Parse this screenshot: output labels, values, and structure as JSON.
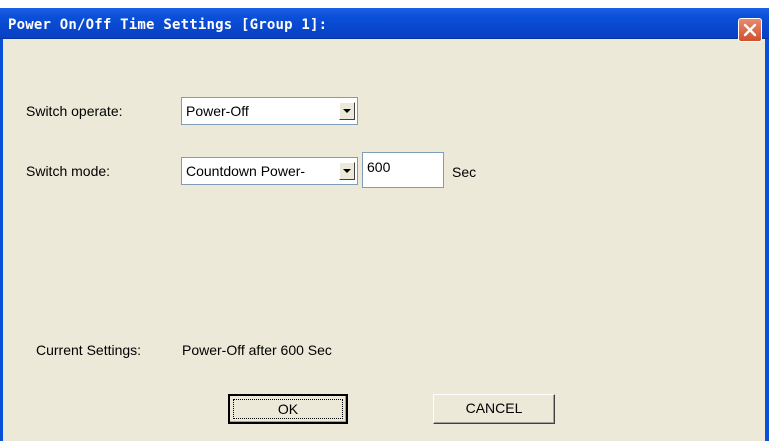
{
  "window": {
    "title": "Power On/Off Time Settings [Group 1]:",
    "close_icon": "close-icon"
  },
  "switch_operate": {
    "label": "Switch operate:",
    "value": "Power-Off"
  },
  "switch_mode": {
    "label": "Switch  mode:",
    "value": "Countdown Power-",
    "seconds_value": "600",
    "unit": "Sec"
  },
  "current_settings": {
    "label": "Current Settings:",
    "value": "Power-Off after 600 Sec"
  },
  "buttons": {
    "ok": "OK",
    "cancel": "CANCEL"
  },
  "colors": {
    "dialog_background": "#ece9d8",
    "titlebar": "#0a4fd8",
    "close_button": "#d0502c"
  }
}
